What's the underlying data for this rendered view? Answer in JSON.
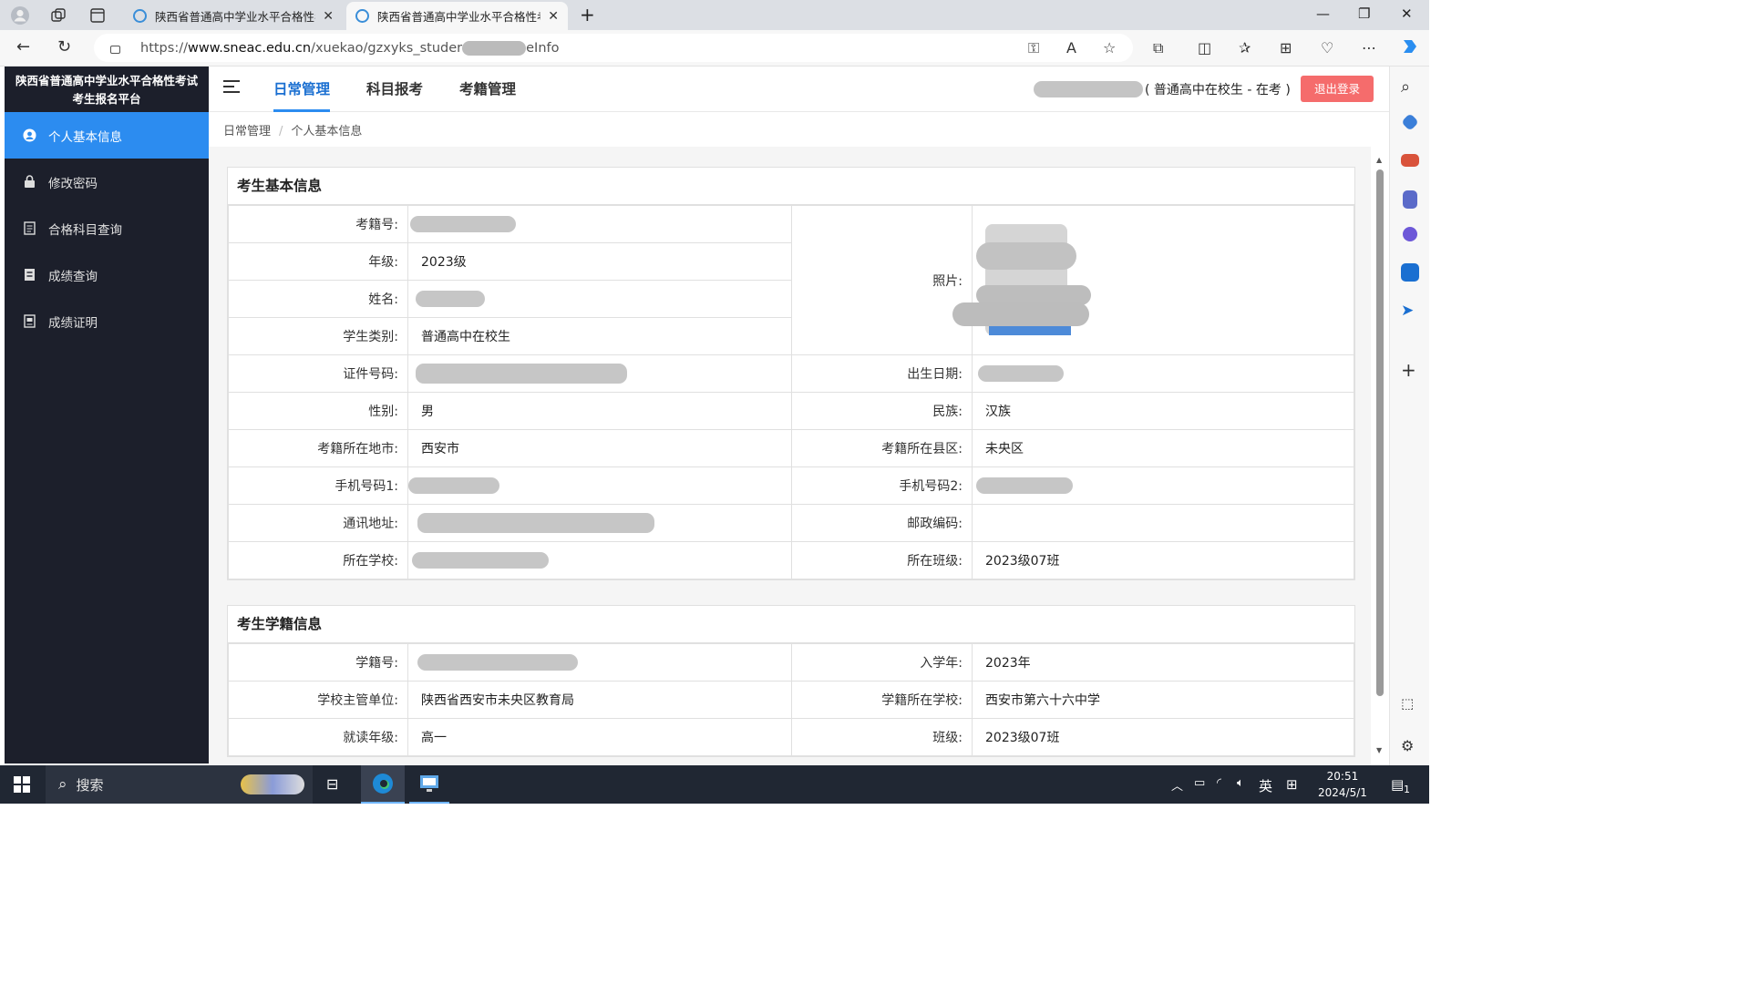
{
  "browser": {
    "tabs": [
      {
        "title": "陕西省普通高中学业水平合格性考试考生报名平台",
        "active": false
      },
      {
        "title": "陕西省普通高中学业水平合格性考试考生报名平台",
        "active": true
      }
    ],
    "url_prefix": "https://",
    "url_host": "www.sneac.edu.cn",
    "url_path_a": "/xuekao/gzxyks_studer",
    "url_path_b": "eInfo"
  },
  "sidebar": {
    "brand_line1": "陕西省普通高中学业水平合格性考试",
    "brand_line2": "考生报名平台",
    "items": [
      {
        "label": "个人基本信息",
        "icon": "user-icon",
        "active": true
      },
      {
        "label": "修改密码",
        "icon": "lock-icon",
        "active": false
      },
      {
        "label": "合格科目查询",
        "icon": "list-icon",
        "active": false
      },
      {
        "label": "成绩查询",
        "icon": "grade-icon",
        "active": false
      },
      {
        "label": "成绩证明",
        "icon": "certificate-icon",
        "active": false
      }
    ]
  },
  "topnav": {
    "tabs": [
      "日常管理",
      "科目报考",
      "考籍管理"
    ],
    "active_tab": "日常管理",
    "user_suffix": "( 普通高中在校生 - 在考 )",
    "logout_label": "退出登录"
  },
  "breadcrumb": [
    "日常管理",
    "个人基本信息"
  ],
  "basic_info": {
    "title": "考生基本信息",
    "labels": {
      "exam_id": "考籍号:",
      "grade": "年级:",
      "name": "姓名:",
      "category": "学生类别:",
      "photo": "照片:",
      "id_number": "证件号码:",
      "birth_date": "出生日期:",
      "gender": "性别:",
      "ethnicity": "民族:",
      "city": "考籍所在地市:",
      "district": "考籍所在县区:",
      "phone1": "手机号码1:",
      "phone2": "手机号码2:",
      "address": "通讯地址:",
      "postcode": "邮政编码:",
      "school": "所在学校:",
      "class": "所在班级:"
    },
    "values": {
      "grade": "2023级",
      "category": "普通高中在校生",
      "gender": "男",
      "ethnicity": "汉族",
      "city": "西安市",
      "district": "未央区",
      "postcode": "",
      "class": "2023级07班"
    }
  },
  "enrollment_info": {
    "title": "考生学籍信息",
    "labels": {
      "student_id": "学籍号:",
      "enroll_year": "入学年:",
      "authority": "学校主管单位:",
      "school": "学籍所在学校:",
      "grade": "就读年级:",
      "class": "班级:"
    },
    "values": {
      "enroll_year": "2023年",
      "authority": "陕西省西安市未央区教育局",
      "school": "西安市第六十六中学",
      "grade": "高一",
      "class": "2023级07班"
    }
  },
  "taskbar": {
    "search_label": "搜索",
    "ime": "英",
    "time": "20:51",
    "date": "2024/5/1",
    "notification_count": "1"
  },
  "colors": {
    "sidebar_bg": "#1c1f2b",
    "sidebar_active": "#2c8cf0",
    "logout": "#f56c6c",
    "tab_active_text": "#1a6fd1"
  }
}
